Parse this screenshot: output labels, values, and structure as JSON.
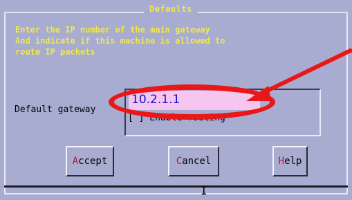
{
  "dialog": {
    "title": "Defaults",
    "instructions": [
      "Enter the IP number of the main gateway",
      "And indicate if this machine is allowed to",
      "route IP packets"
    ]
  },
  "gateway": {
    "label": "Default gateway",
    "value": "10.2.1.1"
  },
  "routing": {
    "label": "[ ] Enable routing"
  },
  "buttons": {
    "accept_hot": "A",
    "accept_rest": "ccept",
    "cancel_hot": "C",
    "cancel_rest": "ancel",
    "help_hot": "H",
    "help_rest": "elp"
  },
  "annotation": {
    "color": "#e81818"
  }
}
